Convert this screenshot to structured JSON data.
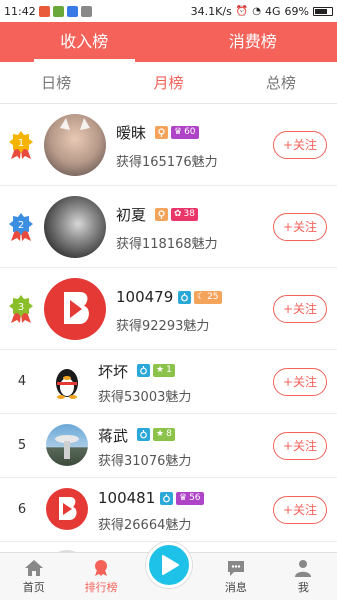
{
  "status": {
    "time": "11:42",
    "speed": "34.1K/s",
    "network": "4G",
    "battery": "69%"
  },
  "header": {
    "tabs": [
      {
        "label": "收入榜"
      },
      {
        "label": "消费榜"
      }
    ]
  },
  "subtabs": [
    {
      "label": "日榜"
    },
    {
      "label": "月榜"
    },
    {
      "label": "总榜"
    }
  ],
  "follow_label": "+关注",
  "rows": [
    {
      "rank": "1",
      "name": "暧昧",
      "level": "60",
      "score": "获得165176魅力"
    },
    {
      "rank": "2",
      "name": "初夏",
      "level": "38",
      "score": "获得118168魅力"
    },
    {
      "rank": "3",
      "name": "100479",
      "level": "25",
      "score": "获得92293魅力"
    },
    {
      "rank": "4",
      "name": "坏坏",
      "level": "1",
      "score": "获得53003魅力"
    },
    {
      "rank": "5",
      "name": "蒋武",
      "level": "8",
      "score": "获得31076魅力"
    },
    {
      "rank": "6",
      "name": "100481",
      "level": "56",
      "score": "获得26664魅力"
    }
  ],
  "nav": {
    "home": "首页",
    "rank": "排行榜",
    "msg": "消息",
    "me": "我"
  },
  "colors": {
    "accent": "#f4625a",
    "play": "#1ec1e8"
  }
}
